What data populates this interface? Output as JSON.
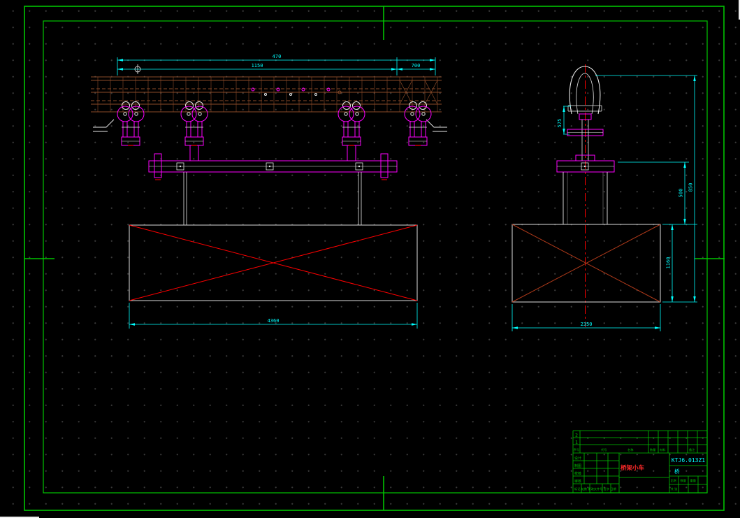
{
  "colors": {
    "background": "#000000",
    "frame_green": "#00c400",
    "dimension_cyan": "#00ffff",
    "part_magenta": "#ff00ff",
    "centerline_red": "#ff0000",
    "beam_brown": "#8a4a28",
    "line_white": "#e8e8e8"
  },
  "front_view": {
    "dim_top_overall": "470",
    "dim_top_left_span": "1150",
    "dim_top_right_span": "700",
    "dim_bottom_overall": "4360"
  },
  "side_view": {
    "dim_hook_height": "575",
    "dim_right_overall": "850",
    "dim_right_upper": "500",
    "dim_right_lower": "1160",
    "dim_bottom_overall": "2350"
  },
  "title_block": {
    "drawing_no": "KTJ6.013Z1",
    "title": "桥架小车",
    "material": "桥",
    "parts_list": {
      "rows": [
        {
          "no": "2"
        },
        {
          "no": "1"
        }
      ],
      "headers": [
        "序号",
        "代号",
        "名称",
        "数量",
        "材料",
        "备注"
      ]
    },
    "signature_rows": [
      "设计",
      "制图",
      "校核",
      "审核"
    ],
    "bottom_labels": "标记 处数 更改文件号 签字 日期",
    "info_labels": [
      "比例",
      "数量",
      "重量",
      "共 张"
    ]
  }
}
